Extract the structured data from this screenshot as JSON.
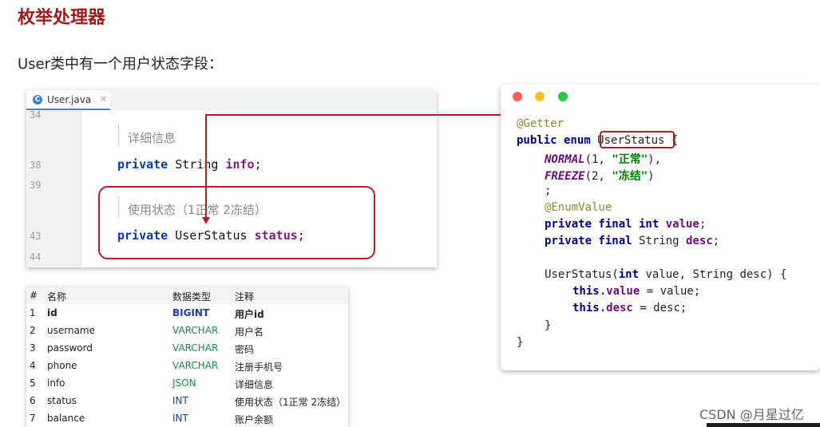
{
  "slide": {
    "title": "枚举处理器",
    "intro": "User类中有一个用户状态字段："
  },
  "ide": {
    "tab_icon": "C",
    "tab_label": "User.java",
    "tab_close": "×",
    "line_numbers": [
      "34",
      "38",
      "39",
      "43",
      "44"
    ],
    "doc_info": "详细信息",
    "doc_status": "使用状态（1正常 2冻结）",
    "line38": {
      "modifier": "private",
      "type": " String ",
      "field": "info",
      "end": ";"
    },
    "line43": {
      "modifier": "private",
      "type": " UserStatus ",
      "field": "status",
      "end": ";"
    }
  },
  "editor_window": {
    "dot_colors": [
      "#ff5f57",
      "#febc2e",
      "#28c840"
    ],
    "lines": {
      "l1": "@Getter",
      "l2_kw": "public enum ",
      "l2_name": "UserStatus",
      "l2_end": " {",
      "l3_const": "NORMAL",
      "l3_a": "(1, ",
      "l3_str": "\"正常\"",
      "l3_b": "),",
      "l4_const": "FREEZE",
      "l4_a": "(2, ",
      "l4_str": "\"冻结\"",
      "l4_b": ")",
      "l5": ";",
      "l6": "@EnumValue",
      "l7_kw": "private final int ",
      "l7_fld": "value",
      "l7_end": ";",
      "l8_kw": "private final ",
      "l8_type": "String ",
      "l8_fld": "desc",
      "l8_end": ";",
      "l9_a": "UserStatus(",
      "l9_kw": "int",
      "l9_b": " value, String desc) {",
      "l10_kw": "this",
      "l10_fld": ".value",
      "l10_end": " = value;",
      "l11_kw": "this",
      "l11_fld": ".desc",
      "l11_end": " = desc;",
      "l12": "}",
      "l13": "}"
    }
  },
  "db_table": {
    "headers": [
      "#",
      "名称",
      "数据类型",
      "注释"
    ],
    "rows": [
      [
        "1",
        "id",
        "BIGINT",
        "用户id"
      ],
      [
        "2",
        "username",
        "VARCHAR",
        "用户名"
      ],
      [
        "3",
        "password",
        "VARCHAR",
        "密码"
      ],
      [
        "4",
        "phone",
        "VARCHAR",
        "注册手机号"
      ],
      [
        "5",
        "info",
        "JSON",
        "详细信息"
      ],
      [
        "6",
        "status",
        "INT",
        "使用状态（1正常 2冻结）"
      ],
      [
        "7",
        "balance",
        "INT",
        "账户余额"
      ]
    ]
  },
  "watermark": "CSDN @月星过亿",
  "colors": {
    "accent": "#b01e2c",
    "title": "#9b1c1c"
  }
}
